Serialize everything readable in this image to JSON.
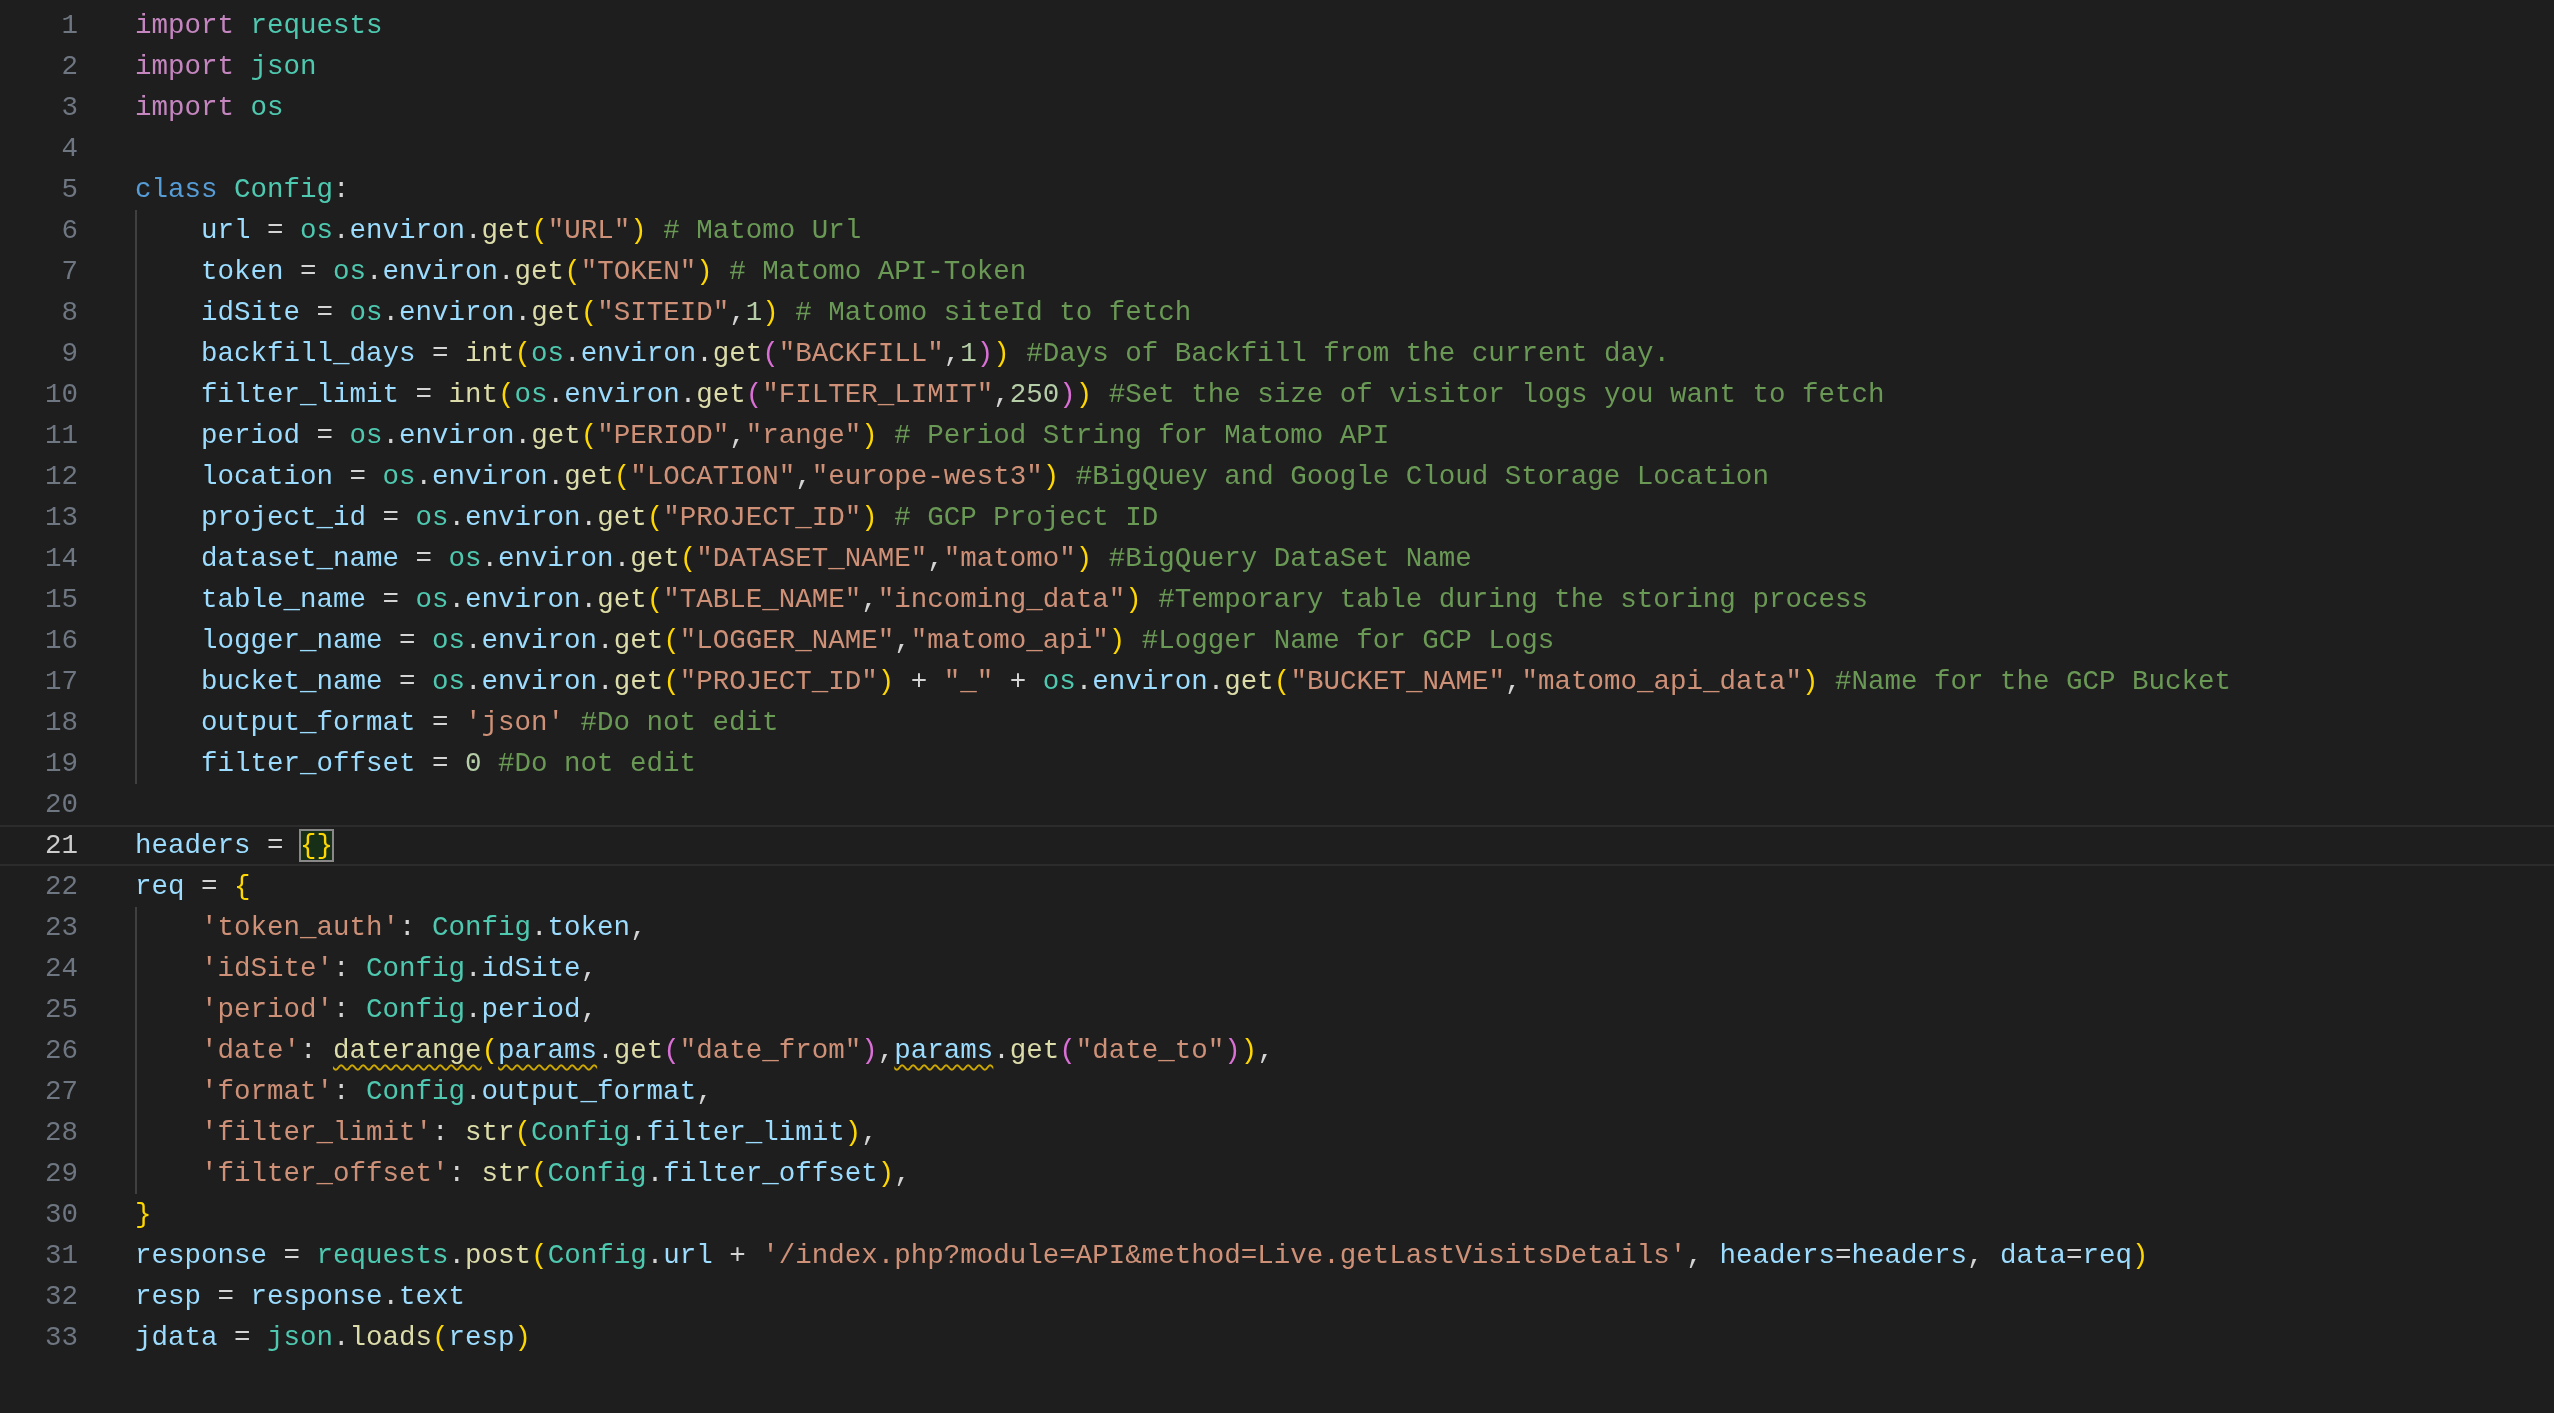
{
  "editor": {
    "lines": [
      {
        "number": "1",
        "tokens": [
          {
            "kind": "kw",
            "text": "import "
          },
          {
            "kind": "ty",
            "text": "requests"
          }
        ]
      },
      {
        "number": "2",
        "tokens": [
          {
            "kind": "kw",
            "text": "import "
          },
          {
            "kind": "ty",
            "text": "json"
          }
        ]
      },
      {
        "number": "3",
        "tokens": [
          {
            "kind": "kw",
            "text": "import "
          },
          {
            "kind": "ty",
            "text": "os"
          }
        ]
      },
      {
        "number": "4"
      },
      {
        "number": "5",
        "tokens": [
          {
            "kind": "st",
            "text": "class "
          },
          {
            "kind": "ty",
            "text": "Config"
          },
          {
            "kind": "p",
            "text": ":"
          }
        ]
      },
      {
        "number": "6",
        "indented": true,
        "tokens": [
          {
            "kind": "v",
            "text": "url"
          },
          {
            "kind": "p",
            "text": " = "
          },
          {
            "kind": "ty",
            "text": "os"
          },
          {
            "kind": "p",
            "text": "."
          },
          {
            "kind": "v",
            "text": "environ"
          },
          {
            "kind": "p",
            "text": "."
          },
          {
            "kind": "f",
            "text": "get"
          },
          {
            "kind": "b1",
            "text": "("
          },
          {
            "kind": "s",
            "text": "\"URL\""
          },
          {
            "kind": "b1",
            "text": ") "
          },
          {
            "kind": "c",
            "text": "# Matomo Url"
          }
        ]
      },
      {
        "number": "7",
        "indented": true,
        "tokens": [
          {
            "kind": "v",
            "text": "token"
          },
          {
            "kind": "p",
            "text": " = "
          },
          {
            "kind": "ty",
            "text": "os"
          },
          {
            "kind": "p",
            "text": "."
          },
          {
            "kind": "v",
            "text": "environ"
          },
          {
            "kind": "p",
            "text": "."
          },
          {
            "kind": "f",
            "text": "get"
          },
          {
            "kind": "b1",
            "text": "("
          },
          {
            "kind": "s",
            "text": "\"TOKEN\""
          },
          {
            "kind": "b1",
            "text": ") "
          },
          {
            "kind": "c",
            "text": "# Matomo API-Token"
          }
        ]
      },
      {
        "number": "8",
        "indented": true,
        "tokens": [
          {
            "kind": "v",
            "text": "idSite"
          },
          {
            "kind": "p",
            "text": " = "
          },
          {
            "kind": "ty",
            "text": "os"
          },
          {
            "kind": "p",
            "text": "."
          },
          {
            "kind": "v",
            "text": "environ"
          },
          {
            "kind": "p",
            "text": "."
          },
          {
            "kind": "f",
            "text": "get"
          },
          {
            "kind": "b1",
            "text": "("
          },
          {
            "kind": "s",
            "text": "\"SITEID\""
          },
          {
            "kind": "p",
            "text": ","
          },
          {
            "kind": "n",
            "text": "1"
          },
          {
            "kind": "b1",
            "text": ") "
          },
          {
            "kind": "c",
            "text": "# Matomo siteId to fetch"
          }
        ]
      },
      {
        "number": "9",
        "indented": true,
        "tokens": [
          {
            "kind": "v",
            "text": "backfill_days"
          },
          {
            "kind": "p",
            "text": " = "
          },
          {
            "kind": "f",
            "text": "int"
          },
          {
            "kind": "b1",
            "text": "("
          },
          {
            "kind": "ty",
            "text": "os"
          },
          {
            "kind": "p",
            "text": "."
          },
          {
            "kind": "v",
            "text": "environ"
          },
          {
            "kind": "p",
            "text": "."
          },
          {
            "kind": "f",
            "text": "get"
          },
          {
            "kind": "b2",
            "text": "("
          },
          {
            "kind": "s",
            "text": "\"BACKFILL\""
          },
          {
            "kind": "p",
            "text": ","
          },
          {
            "kind": "n",
            "text": "1"
          },
          {
            "kind": "b2",
            "text": ")"
          },
          {
            "kind": "b1",
            "text": ") "
          },
          {
            "kind": "c",
            "text": "#Days of Backfill from the current day."
          }
        ]
      },
      {
        "number": "10",
        "indented": true,
        "tokens": [
          {
            "kind": "v",
            "text": "filter_limit"
          },
          {
            "kind": "p",
            "text": " = "
          },
          {
            "kind": "f",
            "text": "int"
          },
          {
            "kind": "b1",
            "text": "("
          },
          {
            "kind": "ty",
            "text": "os"
          },
          {
            "kind": "p",
            "text": "."
          },
          {
            "kind": "v",
            "text": "environ"
          },
          {
            "kind": "p",
            "text": "."
          },
          {
            "kind": "f",
            "text": "get"
          },
          {
            "kind": "b2",
            "text": "("
          },
          {
            "kind": "s",
            "text": "\"FILTER_LIMIT\""
          },
          {
            "kind": "p",
            "text": ","
          },
          {
            "kind": "n",
            "text": "250"
          },
          {
            "kind": "b2",
            "text": ")"
          },
          {
            "kind": "b1",
            "text": ") "
          },
          {
            "kind": "c",
            "text": "#Set the size of visitor logs you want to fetch"
          }
        ]
      },
      {
        "number": "11",
        "indented": true,
        "tokens": [
          {
            "kind": "v",
            "text": "period"
          },
          {
            "kind": "p",
            "text": " = "
          },
          {
            "kind": "ty",
            "text": "os"
          },
          {
            "kind": "p",
            "text": "."
          },
          {
            "kind": "v",
            "text": "environ"
          },
          {
            "kind": "p",
            "text": "."
          },
          {
            "kind": "f",
            "text": "get"
          },
          {
            "kind": "b1",
            "text": "("
          },
          {
            "kind": "s",
            "text": "\"PERIOD\""
          },
          {
            "kind": "p",
            "text": ","
          },
          {
            "kind": "s",
            "text": "\"range\""
          },
          {
            "kind": "b1",
            "text": ") "
          },
          {
            "kind": "c",
            "text": "# Period String for Matomo API"
          }
        ]
      },
      {
        "number": "12",
        "indented": true,
        "tokens": [
          {
            "kind": "v",
            "text": "location"
          },
          {
            "kind": "p",
            "text": " = "
          },
          {
            "kind": "ty",
            "text": "os"
          },
          {
            "kind": "p",
            "text": "."
          },
          {
            "kind": "v",
            "text": "environ"
          },
          {
            "kind": "p",
            "text": "."
          },
          {
            "kind": "f",
            "text": "get"
          },
          {
            "kind": "b1",
            "text": "("
          },
          {
            "kind": "s",
            "text": "\"LOCATION\""
          },
          {
            "kind": "p",
            "text": ","
          },
          {
            "kind": "s",
            "text": "\"europe-west3\""
          },
          {
            "kind": "b1",
            "text": ") "
          },
          {
            "kind": "c",
            "text": "#BigQuey and Google Cloud Storage Location"
          }
        ]
      },
      {
        "number": "13",
        "indented": true,
        "tokens": [
          {
            "kind": "v",
            "text": "project_id"
          },
          {
            "kind": "p",
            "text": " = "
          },
          {
            "kind": "ty",
            "text": "os"
          },
          {
            "kind": "p",
            "text": "."
          },
          {
            "kind": "v",
            "text": "environ"
          },
          {
            "kind": "p",
            "text": "."
          },
          {
            "kind": "f",
            "text": "get"
          },
          {
            "kind": "b1",
            "text": "("
          },
          {
            "kind": "s",
            "text": "\"PROJECT_ID\""
          },
          {
            "kind": "b1",
            "text": ") "
          },
          {
            "kind": "c",
            "text": "# GCP Project ID"
          }
        ]
      },
      {
        "number": "14",
        "indented": true,
        "tokens": [
          {
            "kind": "v",
            "text": "dataset_name"
          },
          {
            "kind": "p",
            "text": " = "
          },
          {
            "kind": "ty",
            "text": "os"
          },
          {
            "kind": "p",
            "text": "."
          },
          {
            "kind": "v",
            "text": "environ"
          },
          {
            "kind": "p",
            "text": "."
          },
          {
            "kind": "f",
            "text": "get"
          },
          {
            "kind": "b1",
            "text": "("
          },
          {
            "kind": "s",
            "text": "\"DATASET_NAME\""
          },
          {
            "kind": "p",
            "text": ","
          },
          {
            "kind": "s",
            "text": "\"matomo\""
          },
          {
            "kind": "b1",
            "text": ") "
          },
          {
            "kind": "c",
            "text": "#BigQuery DataSet Name"
          }
        ]
      },
      {
        "number": "15",
        "indented": true,
        "tokens": [
          {
            "kind": "v",
            "text": "table_name"
          },
          {
            "kind": "p",
            "text": " = "
          },
          {
            "kind": "ty",
            "text": "os"
          },
          {
            "kind": "p",
            "text": "."
          },
          {
            "kind": "v",
            "text": "environ"
          },
          {
            "kind": "p",
            "text": "."
          },
          {
            "kind": "f",
            "text": "get"
          },
          {
            "kind": "b1",
            "text": "("
          },
          {
            "kind": "s",
            "text": "\"TABLE_NAME\""
          },
          {
            "kind": "p",
            "text": ","
          },
          {
            "kind": "s",
            "text": "\"incoming_data\""
          },
          {
            "kind": "b1",
            "text": ") "
          },
          {
            "kind": "c",
            "text": "#Temporary table during the storing process"
          }
        ]
      },
      {
        "number": "16",
        "indented": true,
        "tokens": [
          {
            "kind": "v",
            "text": "logger_name"
          },
          {
            "kind": "p",
            "text": " = "
          },
          {
            "kind": "ty",
            "text": "os"
          },
          {
            "kind": "p",
            "text": "."
          },
          {
            "kind": "v",
            "text": "environ"
          },
          {
            "kind": "p",
            "text": "."
          },
          {
            "kind": "f",
            "text": "get"
          },
          {
            "kind": "b1",
            "text": "("
          },
          {
            "kind": "s",
            "text": "\"LOGGER_NAME\""
          },
          {
            "kind": "p",
            "text": ","
          },
          {
            "kind": "s",
            "text": "\"matomo_api\""
          },
          {
            "kind": "b1",
            "text": ") "
          },
          {
            "kind": "c",
            "text": "#Logger Name for GCP Logs"
          }
        ]
      },
      {
        "number": "17",
        "indented": true,
        "tokens": [
          {
            "kind": "v",
            "text": "bucket_name"
          },
          {
            "kind": "p",
            "text": " = "
          },
          {
            "kind": "ty",
            "text": "os"
          },
          {
            "kind": "p",
            "text": "."
          },
          {
            "kind": "v",
            "text": "environ"
          },
          {
            "kind": "p",
            "text": "."
          },
          {
            "kind": "f",
            "text": "get"
          },
          {
            "kind": "b1",
            "text": "("
          },
          {
            "kind": "s",
            "text": "\"PROJECT_ID\""
          },
          {
            "kind": "b1",
            "text": ")"
          },
          {
            "kind": "p",
            "text": " + "
          },
          {
            "kind": "s",
            "text": "\"_\""
          },
          {
            "kind": "p",
            "text": " + "
          },
          {
            "kind": "ty",
            "text": "os"
          },
          {
            "kind": "p",
            "text": "."
          },
          {
            "kind": "v",
            "text": "environ"
          },
          {
            "kind": "p",
            "text": "."
          },
          {
            "kind": "f",
            "text": "get"
          },
          {
            "kind": "b1",
            "text": "("
          },
          {
            "kind": "s",
            "text": "\"BUCKET_NAME\""
          },
          {
            "kind": "p",
            "text": ","
          },
          {
            "kind": "s",
            "text": "\"matomo_api_data\""
          },
          {
            "kind": "b1",
            "text": ") "
          },
          {
            "kind": "c",
            "text": "#Name for the GCP Bucket"
          }
        ]
      },
      {
        "number": "18",
        "indented": true,
        "tokens": [
          {
            "kind": "v",
            "text": "output_format"
          },
          {
            "kind": "p",
            "text": " = "
          },
          {
            "kind": "s",
            "text": "'json' "
          },
          {
            "kind": "c",
            "text": "#Do not edit"
          }
        ]
      },
      {
        "number": "19",
        "indented": true,
        "tokens": [
          {
            "kind": "v",
            "text": "filter_offset"
          },
          {
            "kind": "p",
            "text": " = "
          },
          {
            "kind": "n",
            "text": "0 "
          },
          {
            "kind": "c",
            "text": "#Do not edit"
          }
        ]
      },
      {
        "number": "20"
      },
      {
        "number": "21",
        "current": true,
        "tokens": [
          {
            "kind": "v",
            "text": "headers"
          },
          {
            "kind": "p",
            "text": " = "
          },
          {
            "kind": "b1",
            "text": "{}",
            "matched": true
          }
        ]
      },
      {
        "number": "22",
        "tokens": [
          {
            "kind": "v",
            "text": "req"
          },
          {
            "kind": "p",
            "text": " = "
          },
          {
            "kind": "b1",
            "text": "{"
          }
        ]
      },
      {
        "number": "23",
        "indented": true,
        "tokens": [
          {
            "kind": "s",
            "text": "'token_auth'"
          },
          {
            "kind": "p",
            "text": ": "
          },
          {
            "kind": "ty",
            "text": "Config"
          },
          {
            "kind": "p",
            "text": "."
          },
          {
            "kind": "v",
            "text": "token"
          },
          {
            "kind": "p",
            "text": ","
          }
        ]
      },
      {
        "number": "24",
        "indented": true,
        "tokens": [
          {
            "kind": "s",
            "text": "'idSite'"
          },
          {
            "kind": "p",
            "text": ": "
          },
          {
            "kind": "ty",
            "text": "Config"
          },
          {
            "kind": "p",
            "text": "."
          },
          {
            "kind": "v",
            "text": "idSite"
          },
          {
            "kind": "p",
            "text": ","
          }
        ]
      },
      {
        "number": "25",
        "indented": true,
        "tokens": [
          {
            "kind": "s",
            "text": "'period'"
          },
          {
            "kind": "p",
            "text": ": "
          },
          {
            "kind": "ty",
            "text": "Config"
          },
          {
            "kind": "p",
            "text": "."
          },
          {
            "kind": "v",
            "text": "period"
          },
          {
            "kind": "p",
            "text": ","
          }
        ]
      },
      {
        "number": "26",
        "indented": true,
        "tokens": [
          {
            "kind": "s",
            "text": "'date'"
          },
          {
            "kind": "p",
            "text": ": "
          },
          {
            "kind": "f",
            "text": "daterange",
            "warning": true
          },
          {
            "kind": "b1",
            "text": "("
          },
          {
            "kind": "v",
            "text": "params",
            "warning": true
          },
          {
            "kind": "p",
            "text": "."
          },
          {
            "kind": "f",
            "text": "get"
          },
          {
            "kind": "b2",
            "text": "("
          },
          {
            "kind": "s",
            "text": "\"date_from\""
          },
          {
            "kind": "b2",
            "text": ")"
          },
          {
            "kind": "p",
            "text": ","
          },
          {
            "kind": "v",
            "text": "params",
            "warning": true
          },
          {
            "kind": "p",
            "text": "."
          },
          {
            "kind": "f",
            "text": "get"
          },
          {
            "kind": "b2",
            "text": "("
          },
          {
            "kind": "s",
            "text": "\"date_to\""
          },
          {
            "kind": "b2",
            "text": ")"
          },
          {
            "kind": "b1",
            "text": ")"
          },
          {
            "kind": "p",
            "text": ","
          }
        ]
      },
      {
        "number": "27",
        "indented": true,
        "tokens": [
          {
            "kind": "s",
            "text": "'format'"
          },
          {
            "kind": "p",
            "text": ": "
          },
          {
            "kind": "ty",
            "text": "Config"
          },
          {
            "kind": "p",
            "text": "."
          },
          {
            "kind": "v",
            "text": "output_format"
          },
          {
            "kind": "p",
            "text": ","
          }
        ]
      },
      {
        "number": "28",
        "indented": true,
        "tokens": [
          {
            "kind": "s",
            "text": "'filter_limit'"
          },
          {
            "kind": "p",
            "text": ": "
          },
          {
            "kind": "f",
            "text": "str"
          },
          {
            "kind": "b1",
            "text": "("
          },
          {
            "kind": "ty",
            "text": "Config"
          },
          {
            "kind": "p",
            "text": "."
          },
          {
            "kind": "v",
            "text": "filter_limit"
          },
          {
            "kind": "b1",
            "text": ")"
          },
          {
            "kind": "p",
            "text": ","
          }
        ]
      },
      {
        "number": "29",
        "indented": true,
        "tokens": [
          {
            "kind": "s",
            "text": "'filter_offset'"
          },
          {
            "kind": "p",
            "text": ": "
          },
          {
            "kind": "f",
            "text": "str"
          },
          {
            "kind": "b1",
            "text": "("
          },
          {
            "kind": "ty",
            "text": "Config"
          },
          {
            "kind": "p",
            "text": "."
          },
          {
            "kind": "v",
            "text": "filter_offset"
          },
          {
            "kind": "b1",
            "text": ")"
          },
          {
            "kind": "p",
            "text": ","
          }
        ]
      },
      {
        "number": "30",
        "tokens": [
          {
            "kind": "b1",
            "text": "}"
          }
        ]
      },
      {
        "number": "31",
        "tokens": [
          {
            "kind": "v",
            "text": "response"
          },
          {
            "kind": "p",
            "text": " = "
          },
          {
            "kind": "ty",
            "text": "requests"
          },
          {
            "kind": "p",
            "text": "."
          },
          {
            "kind": "f",
            "text": "post"
          },
          {
            "kind": "b1",
            "text": "("
          },
          {
            "kind": "ty",
            "text": "Config"
          },
          {
            "kind": "p",
            "text": "."
          },
          {
            "kind": "v",
            "text": "url"
          },
          {
            "kind": "p",
            "text": " + "
          },
          {
            "kind": "s",
            "text": "'/index.php?module=API&method=Live.getLastVisitsDetails'"
          },
          {
            "kind": "p",
            "text": ", "
          },
          {
            "kind": "v",
            "text": "headers"
          },
          {
            "kind": "p",
            "text": "="
          },
          {
            "kind": "v",
            "text": "headers"
          },
          {
            "kind": "p",
            "text": ", "
          },
          {
            "kind": "v",
            "text": "data"
          },
          {
            "kind": "p",
            "text": "="
          },
          {
            "kind": "v",
            "text": "req"
          },
          {
            "kind": "b1",
            "text": ")"
          }
        ]
      },
      {
        "number": "32",
        "tokens": [
          {
            "kind": "v",
            "text": "resp"
          },
          {
            "kind": "p",
            "text": " = "
          },
          {
            "kind": "v",
            "text": "response"
          },
          {
            "kind": "p",
            "text": "."
          },
          {
            "kind": "v",
            "text": "text"
          }
        ]
      },
      {
        "number": "33",
        "tokens": [
          {
            "kind": "v",
            "text": "jdata"
          },
          {
            "kind": "p",
            "text": " = "
          },
          {
            "kind": "ty",
            "text": "json"
          },
          {
            "kind": "p",
            "text": "."
          },
          {
            "kind": "f",
            "text": "loads"
          },
          {
            "kind": "b1",
            "text": "("
          },
          {
            "kind": "v",
            "text": "resp"
          },
          {
            "kind": "b1",
            "text": ")"
          }
        ]
      }
    ]
  }
}
